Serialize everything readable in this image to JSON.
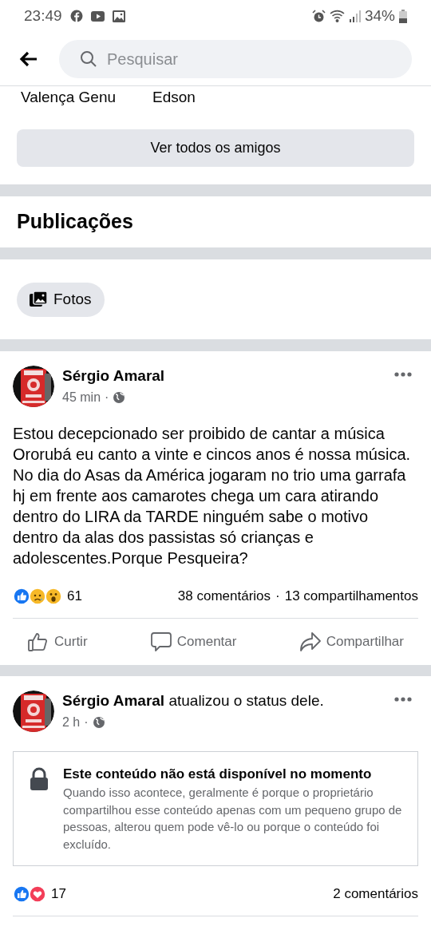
{
  "status_bar": {
    "time": "23:49",
    "battery": "34%"
  },
  "header": {
    "search": {
      "placeholder": "Pesquisar"
    }
  },
  "friends": {
    "names": [
      "Valença Genu",
      "Edson"
    ],
    "button": "Ver todos os amigos"
  },
  "section_title": "Publicações",
  "chips": [
    "Fotos"
  ],
  "posts": [
    {
      "author": "Sérgio Amaral",
      "time": "45 min",
      "meta_separator": "·",
      "stats_separator": "·",
      "text": "Estou decepcionado ser proibido de cantar a música Ororubá eu canto a vinte e cincos anos é nossa música. No dia do Asas da América jogaram no trio uma garrafa hj em frente aos camarotes chega um cara atirando dentro do LIRA da TARDE ninguém sabe o motivo dentro da alas dos passistas só crianças e adolescentes.Porque Pesqueira?",
      "reactions": [
        {
          "kind": "like"
        },
        {
          "kind": "sad"
        },
        {
          "kind": "wow"
        }
      ],
      "reaction_count": "61",
      "comments": "38 comentários",
      "shares": "13 compartilhamentos",
      "actions": [
        "Curtir",
        "Comentar",
        "Compartilhar"
      ]
    },
    {
      "author": "Sérgio Amaral",
      "action": "atualizou o status dele.",
      "time": "2 h",
      "meta_separator": "·",
      "unavailable": {
        "title": "Este conteúdo não está disponível no momento",
        "body": "Quando isso acontece, geralmente é porque o proprietário compartilhou esse conteúdo apenas com um pequeno grupo de pessoas, alterou quem pode vê-lo ou porque o conteúdo foi excluído."
      },
      "reactions": [
        {
          "kind": "like"
        },
        {
          "kind": "love"
        }
      ],
      "reaction_count": "17",
      "comments": "2 comentários"
    }
  ]
}
